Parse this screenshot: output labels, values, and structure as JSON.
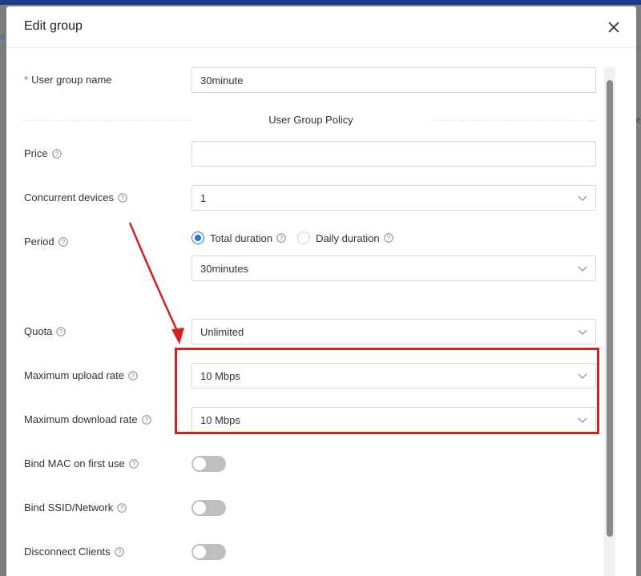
{
  "modal": {
    "title": "Edit group"
  },
  "background": {
    "left_edge_text": "o",
    "right_edge_text": "e"
  },
  "form": {
    "user_group_name_label": "User group name",
    "user_group_name_value": "30minute",
    "section_title": "User Group Policy",
    "price_label": "Price",
    "price_value": "",
    "concurrent_devices_label": "Concurrent devices",
    "concurrent_devices_value": "1",
    "period_label": "Period",
    "period_options": [
      "Total duration",
      "Daily duration"
    ],
    "period_selected": "Total duration",
    "period_value": "30minutes",
    "quota_label": "Quota",
    "quota_value": "Unlimited",
    "max_upload_label": "Maximum upload rate",
    "max_upload_value": "10 Mbps",
    "max_download_label": "Maximum download rate",
    "max_download_value": "10 Mbps",
    "bind_mac_label": "Bind MAC on first use",
    "bind_mac_on": false,
    "bind_ssid_label": "Bind SSID/Network",
    "bind_ssid_on": false,
    "disconnect_label": "Disconnect Clients",
    "disconnect_on": false
  },
  "icons": {
    "help": "question-circle-icon",
    "chevron": "chevron-down-icon",
    "close": "close-icon"
  },
  "colors": {
    "accent": "#1f74e0",
    "annotation": "#d62020",
    "required": "#e53935"
  }
}
